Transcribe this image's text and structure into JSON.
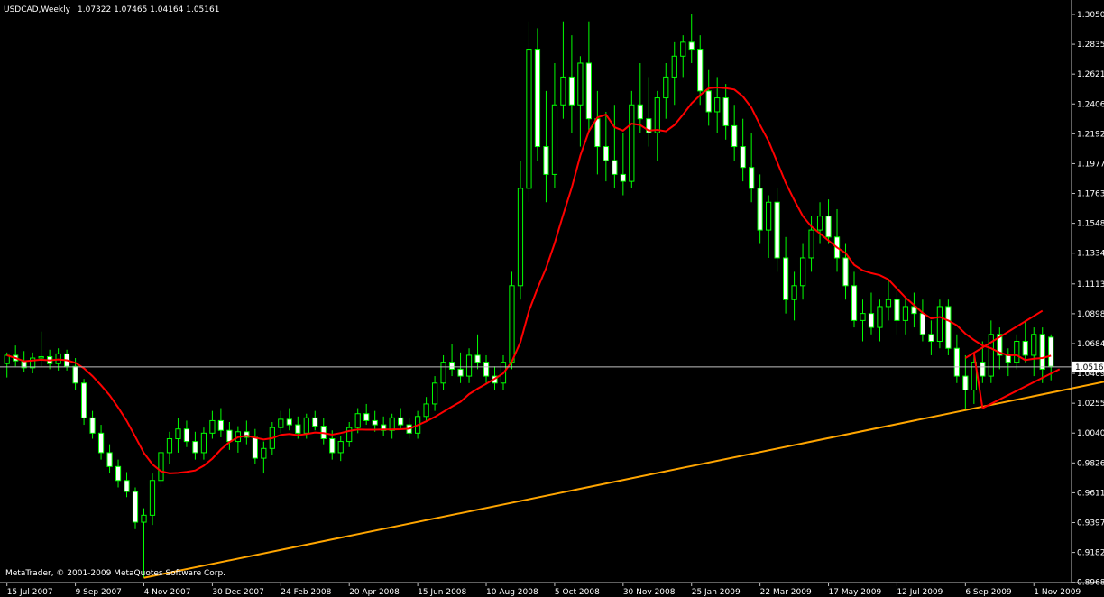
{
  "header": {
    "symbol": "USDCAD,Weekly",
    "ohlc": "1.07322 1.07465 1.04164 1.05161"
  },
  "footer": {
    "copyright": "MetaTrader, © 2001-2009 MetaQuotes Software Corp."
  },
  "colors": {
    "background": "#000000",
    "candle_bull_fill": "#000000",
    "candle_bear_fill": "#ffffff",
    "candle_outline": "#00ff00",
    "moving_average": "#ff0000",
    "trendline": "#ffa500",
    "triangle": "#ff0000",
    "bid_line": "#c0c0c0",
    "axis": "#c0c0c0",
    "text": "#ffffff"
  },
  "chart_data": {
    "type": "candlestick",
    "symbol": "USDCAD",
    "timeframe": "Weekly",
    "ylim": [
      0.8966,
      1.305
    ],
    "y_ticks": [
      "1.30500",
      "1.28355",
      "1.26210",
      "1.24065",
      "1.21920",
      "1.19775",
      "1.17630",
      "1.15485",
      "1.13340",
      "1.11130",
      "1.08985",
      "1.06840",
      "1.04695",
      "1.02550",
      "1.00405",
      "0.98260",
      "0.96115",
      "0.93970",
      "0.91825",
      "0.89680"
    ],
    "current_price_label": "1.05161",
    "current_price": 1.05161,
    "x_ticks": [
      {
        "label": "15 Jul 2007",
        "index": 0
      },
      {
        "label": "9 Sep 2007",
        "index": 8
      },
      {
        "label": "4 Nov 2007",
        "index": 16
      },
      {
        "label": "30 Dec 2007",
        "index": 24
      },
      {
        "label": "24 Feb 2008",
        "index": 32
      },
      {
        "label": "20 Apr 2008",
        "index": 40
      },
      {
        "label": "15 Jun 2008",
        "index": 48
      },
      {
        "label": "10 Aug 2008",
        "index": 56
      },
      {
        "label": "5 Oct 2008",
        "index": 64
      },
      {
        "label": "30 Nov 2008",
        "index": 72
      },
      {
        "label": "25 Jan 2009",
        "index": 80
      },
      {
        "label": "22 Mar 2009",
        "index": 88
      },
      {
        "label": "17 May 2009",
        "index": 96
      },
      {
        "label": "12 Jul 2009",
        "index": 104
      },
      {
        "label": "6 Sep 2009",
        "index": 112
      },
      {
        "label": "1 Nov 2009",
        "index": 120
      }
    ],
    "bar_count": 123,
    "candles": [
      [
        1.054,
        1.062,
        1.044,
        1.06
      ],
      [
        1.06,
        1.067,
        1.052,
        1.056
      ],
      [
        1.056,
        1.063,
        1.048,
        1.051
      ],
      [
        1.051,
        1.062,
        1.047,
        1.058
      ],
      [
        1.058,
        1.077,
        1.052,
        1.059
      ],
      [
        1.059,
        1.064,
        1.05,
        1.054
      ],
      [
        1.054,
        1.065,
        1.049,
        1.061
      ],
      [
        1.061,
        1.064,
        1.049,
        1.052
      ],
      [
        1.052,
        1.058,
        1.035,
        1.04
      ],
      [
        1.04,
        1.043,
        1.01,
        1.015
      ],
      [
        1.015,
        1.02,
        1.0,
        1.004
      ],
      [
        1.004,
        1.01,
        0.985,
        0.99
      ],
      [
        0.99,
        0.996,
        0.975,
        0.98
      ],
      [
        0.98,
        0.985,
        0.965,
        0.97
      ],
      [
        0.97,
        0.976,
        0.958,
        0.962
      ],
      [
        0.962,
        0.965,
        0.935,
        0.94
      ],
      [
        0.94,
        0.95,
        0.9,
        0.945
      ],
      [
        0.945,
        0.975,
        0.938,
        0.97
      ],
      [
        0.97,
        0.995,
        0.965,
        0.99
      ],
      [
        0.99,
        1.005,
        0.982,
        1.0
      ],
      [
        1.0,
        1.015,
        0.99,
        1.007
      ],
      [
        1.007,
        1.013,
        0.994,
        0.998
      ],
      [
        0.998,
        1.005,
        0.985,
        0.99
      ],
      [
        0.99,
        1.008,
        0.985,
        1.004
      ],
      [
        1.004,
        1.02,
        1.0,
        1.013
      ],
      [
        1.013,
        1.022,
        1.001,
        1.006
      ],
      [
        1.006,
        1.012,
        0.992,
        0.998
      ],
      [
        0.998,
        1.009,
        0.99,
        1.005
      ],
      [
        1.005,
        1.013,
        0.996,
        1.001
      ],
      [
        1.001,
        1.007,
        0.982,
        0.986
      ],
      [
        0.986,
        0.998,
        0.975,
        0.993
      ],
      [
        0.993,
        1.012,
        0.988,
        1.008
      ],
      [
        1.008,
        1.02,
        1.004,
        1.014
      ],
      [
        1.014,
        1.022,
        1.006,
        1.01
      ],
      [
        1.01,
        1.016,
        1.0,
        1.004
      ],
      [
        1.004,
        1.018,
        1.0,
        1.015
      ],
      [
        1.015,
        1.02,
        1.006,
        1.009
      ],
      [
        1.009,
        1.015,
        0.996,
        1.0
      ],
      [
        1.0,
        1.006,
        0.985,
        0.99
      ],
      [
        0.99,
        1.002,
        0.984,
        0.998
      ],
      [
        0.998,
        1.012,
        0.994,
        1.008
      ],
      [
        1.008,
        1.022,
        1.004,
        1.018
      ],
      [
        1.018,
        1.025,
        1.01,
        1.013
      ],
      [
        1.013,
        1.02,
        1.005,
        1.01
      ],
      [
        1.01,
        1.016,
        1.002,
        1.006
      ],
      [
        1.006,
        1.018,
        1.0,
        1.015
      ],
      [
        1.015,
        1.022,
        1.007,
        1.01
      ],
      [
        1.01,
        1.015,
        1.0,
        1.004
      ],
      [
        1.004,
        1.02,
        1.0,
        1.016
      ],
      [
        1.016,
        1.03,
        1.012,
        1.025
      ],
      [
        1.025,
        1.045,
        1.02,
        1.04
      ],
      [
        1.04,
        1.06,
        1.035,
        1.055
      ],
      [
        1.055,
        1.068,
        1.045,
        1.05
      ],
      [
        1.05,
        1.062,
        1.04,
        1.045
      ],
      [
        1.045,
        1.065,
        1.04,
        1.06
      ],
      [
        1.06,
        1.075,
        1.05,
        1.055
      ],
      [
        1.055,
        1.06,
        1.04,
        1.045
      ],
      [
        1.045,
        1.052,
        1.035,
        1.04
      ],
      [
        1.04,
        1.06,
        1.035,
        1.055
      ],
      [
        1.055,
        1.12,
        1.05,
        1.11
      ],
      [
        1.11,
        1.2,
        1.1,
        1.18
      ],
      [
        1.18,
        1.3,
        1.17,
        1.28
      ],
      [
        1.28,
        1.295,
        1.2,
        1.21
      ],
      [
        1.21,
        1.25,
        1.17,
        1.19
      ],
      [
        1.19,
        1.27,
        1.18,
        1.24
      ],
      [
        1.24,
        1.3,
        1.23,
        1.26
      ],
      [
        1.26,
        1.29,
        1.22,
        1.24
      ],
      [
        1.24,
        1.275,
        1.21,
        1.27
      ],
      [
        1.27,
        1.3,
        1.22,
        1.23
      ],
      [
        1.23,
        1.25,
        1.19,
        1.21
      ],
      [
        1.21,
        1.235,
        1.185,
        1.2
      ],
      [
        1.2,
        1.24,
        1.18,
        1.19
      ],
      [
        1.19,
        1.22,
        1.175,
        1.185
      ],
      [
        1.185,
        1.25,
        1.18,
        1.24
      ],
      [
        1.24,
        1.27,
        1.22,
        1.23
      ],
      [
        1.23,
        1.26,
        1.21,
        1.22
      ],
      [
        1.22,
        1.25,
        1.2,
        1.245
      ],
      [
        1.245,
        1.27,
        1.23,
        1.26
      ],
      [
        1.26,
        1.285,
        1.24,
        1.275
      ],
      [
        1.275,
        1.29,
        1.26,
        1.285
      ],
      [
        1.285,
        1.305,
        1.27,
        1.28
      ],
      [
        1.28,
        1.29,
        1.24,
        1.25
      ],
      [
        1.25,
        1.265,
        1.225,
        1.235
      ],
      [
        1.235,
        1.26,
        1.22,
        1.245
      ],
      [
        1.245,
        1.255,
        1.215,
        1.225
      ],
      [
        1.225,
        1.24,
        1.2,
        1.21
      ],
      [
        1.21,
        1.23,
        1.185,
        1.195
      ],
      [
        1.195,
        1.22,
        1.17,
        1.18
      ],
      [
        1.18,
        1.19,
        1.14,
        1.15
      ],
      [
        1.15,
        1.175,
        1.13,
        1.17
      ],
      [
        1.17,
        1.18,
        1.12,
        1.13
      ],
      [
        1.13,
        1.145,
        1.09,
        1.1
      ],
      [
        1.1,
        1.12,
        1.085,
        1.11
      ],
      [
        1.11,
        1.14,
        1.1,
        1.13
      ],
      [
        1.13,
        1.16,
        1.12,
        1.15
      ],
      [
        1.15,
        1.17,
        1.14,
        1.16
      ],
      [
        1.16,
        1.172,
        1.14,
        1.145
      ],
      [
        1.145,
        1.165,
        1.12,
        1.13
      ],
      [
        1.13,
        1.14,
        1.1,
        1.11
      ],
      [
        1.11,
        1.12,
        1.08,
        1.085
      ],
      [
        1.085,
        1.1,
        1.07,
        1.09
      ],
      [
        1.09,
        1.105,
        1.075,
        1.08
      ],
      [
        1.08,
        1.1,
        1.07,
        1.095
      ],
      [
        1.095,
        1.115,
        1.085,
        1.1
      ],
      [
        1.1,
        1.11,
        1.075,
        1.085
      ],
      [
        1.085,
        1.102,
        1.075,
        1.095
      ],
      [
        1.095,
        1.105,
        1.08,
        1.09
      ],
      [
        1.09,
        1.1,
        1.07,
        1.075
      ],
      [
        1.075,
        1.085,
        1.06,
        1.07
      ],
      [
        1.07,
        1.1,
        1.065,
        1.095
      ],
      [
        1.095,
        1.1,
        1.06,
        1.065
      ],
      [
        1.065,
        1.075,
        1.04,
        1.045
      ],
      [
        1.045,
        1.06,
        1.02,
        1.035
      ],
      [
        1.035,
        1.06,
        1.025,
        1.055
      ],
      [
        1.055,
        1.07,
        1.04,
        1.045
      ],
      [
        1.045,
        1.085,
        1.04,
        1.075
      ],
      [
        1.075,
        1.08,
        1.05,
        1.06
      ],
      [
        1.06,
        1.065,
        1.045,
        1.055
      ],
      [
        1.055,
        1.075,
        1.05,
        1.07
      ],
      [
        1.07,
        1.085,
        1.055,
        1.06
      ],
      [
        1.06,
        1.08,
        1.045,
        1.075
      ],
      [
        1.075,
        1.08,
        1.04,
        1.05
      ],
      [
        1.073,
        1.075,
        1.042,
        1.052
      ]
    ],
    "ma_period": 10,
    "trendline": {
      "from": {
        "index": 16,
        "price": 0.9
      },
      "to": {
        "index": 145,
        "price": 1.062
      }
    },
    "triangle": {
      "upper": {
        "from": {
          "index": 112,
          "price": 1.058
        },
        "to": {
          "index": 121,
          "price": 1.092
        }
      },
      "lower": {
        "from": {
          "index": 114,
          "price": 1.022
        },
        "to": {
          "index": 123,
          "price": 1.05
        }
      },
      "apex_connect": {
        "from": {
          "index": 113,
          "price": 1.0615
        },
        "to": {
          "index": 114,
          "price": 1.022
        }
      }
    }
  }
}
